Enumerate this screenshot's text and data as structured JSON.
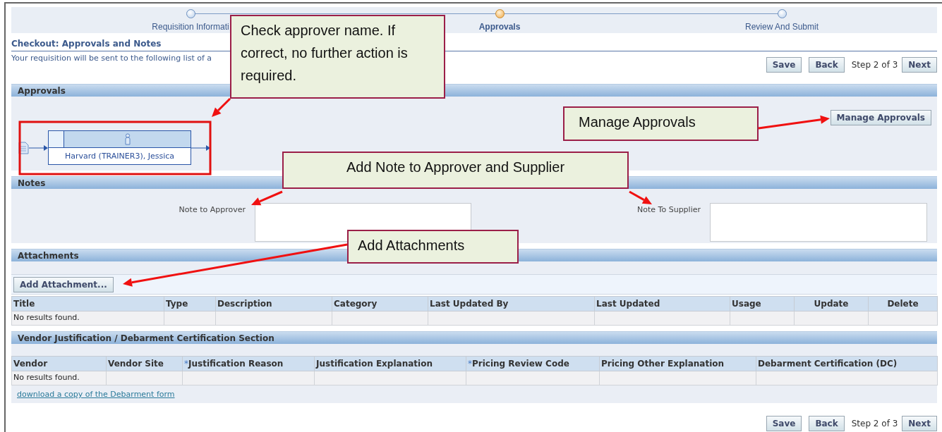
{
  "steps": [
    {
      "label": "Requisition Informati",
      "selected": false
    },
    {
      "label": "Approvals",
      "selected": true
    },
    {
      "label": "Review And Submit",
      "selected": false
    }
  ],
  "page": {
    "title": "Checkout: Approvals and Notes",
    "subtitle": "Your requisition will be sent to the following list of a"
  },
  "top_navigation": [
    {
      "kind": "button",
      "label": "Save"
    },
    {
      "kind": "button",
      "label": "Back"
    },
    {
      "kind": "text",
      "label": "Step 2 of 3"
    },
    {
      "kind": "button",
      "label": "Next"
    }
  ],
  "approvals": {
    "header": "Approvals",
    "approvers": [
      {
        "name": "Harvard (TRAINER3), Jessica"
      }
    ],
    "manage_button": "Manage Approvals"
  },
  "notes": {
    "header": "Notes",
    "fields": [
      {
        "label": "Note to Approver"
      },
      {
        "label": "Note To Supplier"
      }
    ]
  },
  "attachments": {
    "header": "Attachments",
    "add_button": "Add Attachment...",
    "table": {
      "columns": [
        {
          "label": "Title",
          "centered": false
        },
        {
          "label": "Type",
          "centered": false
        },
        {
          "label": "Description",
          "centered": false
        },
        {
          "label": "Category",
          "centered": false
        },
        {
          "label": "Last Updated By",
          "centered": false
        },
        {
          "label": "Last Updated",
          "centered": false
        },
        {
          "label": "Usage",
          "centered": false
        },
        {
          "label": "Update",
          "centered": true
        },
        {
          "label": "Delete",
          "centered": true
        }
      ],
      "empty_text": "No results found."
    }
  },
  "vendor_section": {
    "header": "Vendor Justification / Debarment Certification Section",
    "table": {
      "columns": [
        {
          "label": "Vendor"
        },
        {
          "label": "Vendor Site"
        },
        {
          "label": "Justification Reason",
          "required_mark": "*"
        },
        {
          "label": "Justification Explanation"
        },
        {
          "label": "Pricing Review Code",
          "required_mark": "*"
        },
        {
          "label": "Pricing Other Explanation"
        },
        {
          "label": "Debarment Certification (DC)"
        }
      ],
      "empty_text": "No results found."
    },
    "link": "download a copy of the Debarment form"
  },
  "bottom_navigation": [
    {
      "kind": "button",
      "label": "Save"
    },
    {
      "kind": "button",
      "label": "Back"
    },
    {
      "kind": "text",
      "label": "Step 2 of 3"
    },
    {
      "kind": "button",
      "label": "Next"
    }
  ],
  "annotations": [
    {
      "text": "Check approver name. If correct, no further action is required."
    },
    {
      "text": "Manage Approvals"
    },
    {
      "text": "Add Note to Approver and Supplier"
    },
    {
      "text": "Add Attachments"
    }
  ]
}
